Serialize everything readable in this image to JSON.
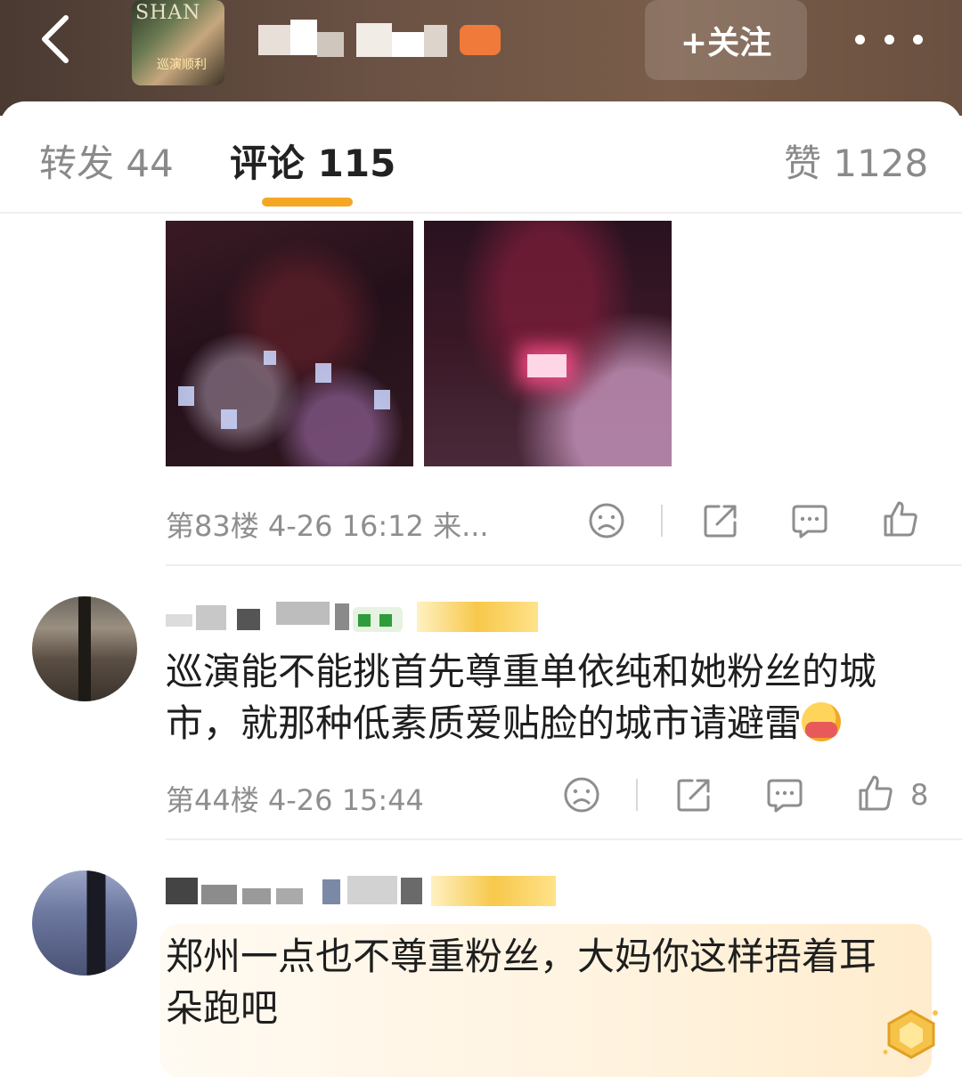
{
  "header": {
    "follow_label": "+关注",
    "cover_text": "SHAN",
    "cover_sub": "巡演顺利"
  },
  "tabs": [
    {
      "label": "转发 44"
    },
    {
      "label": "评论 115"
    },
    {
      "label": "赞 1128"
    }
  ],
  "colors": {
    "accent": "#f5a623",
    "header_bg": "#6b5244",
    "meta_text": "#8e8e8e"
  },
  "post": {
    "meta": "第83楼 4-26 16:12 来..."
  },
  "comments": [
    {
      "text": "巡演能不能挑首先尊重单依纯和她粉丝的城市，就那种低素质爱贴脸的城市请避雷",
      "meta": "第44楼 4-26 15:44",
      "likes": "8"
    },
    {
      "text": "郑州一点也不尊重粉丝，大妈你这样捂着耳朵跑吧"
    }
  ],
  "icons": [
    "back-icon",
    "more-icon",
    "dislike-icon",
    "share-icon",
    "comment-icon",
    "like-icon",
    "hug-emoji-icon",
    "badge-icon"
  ]
}
